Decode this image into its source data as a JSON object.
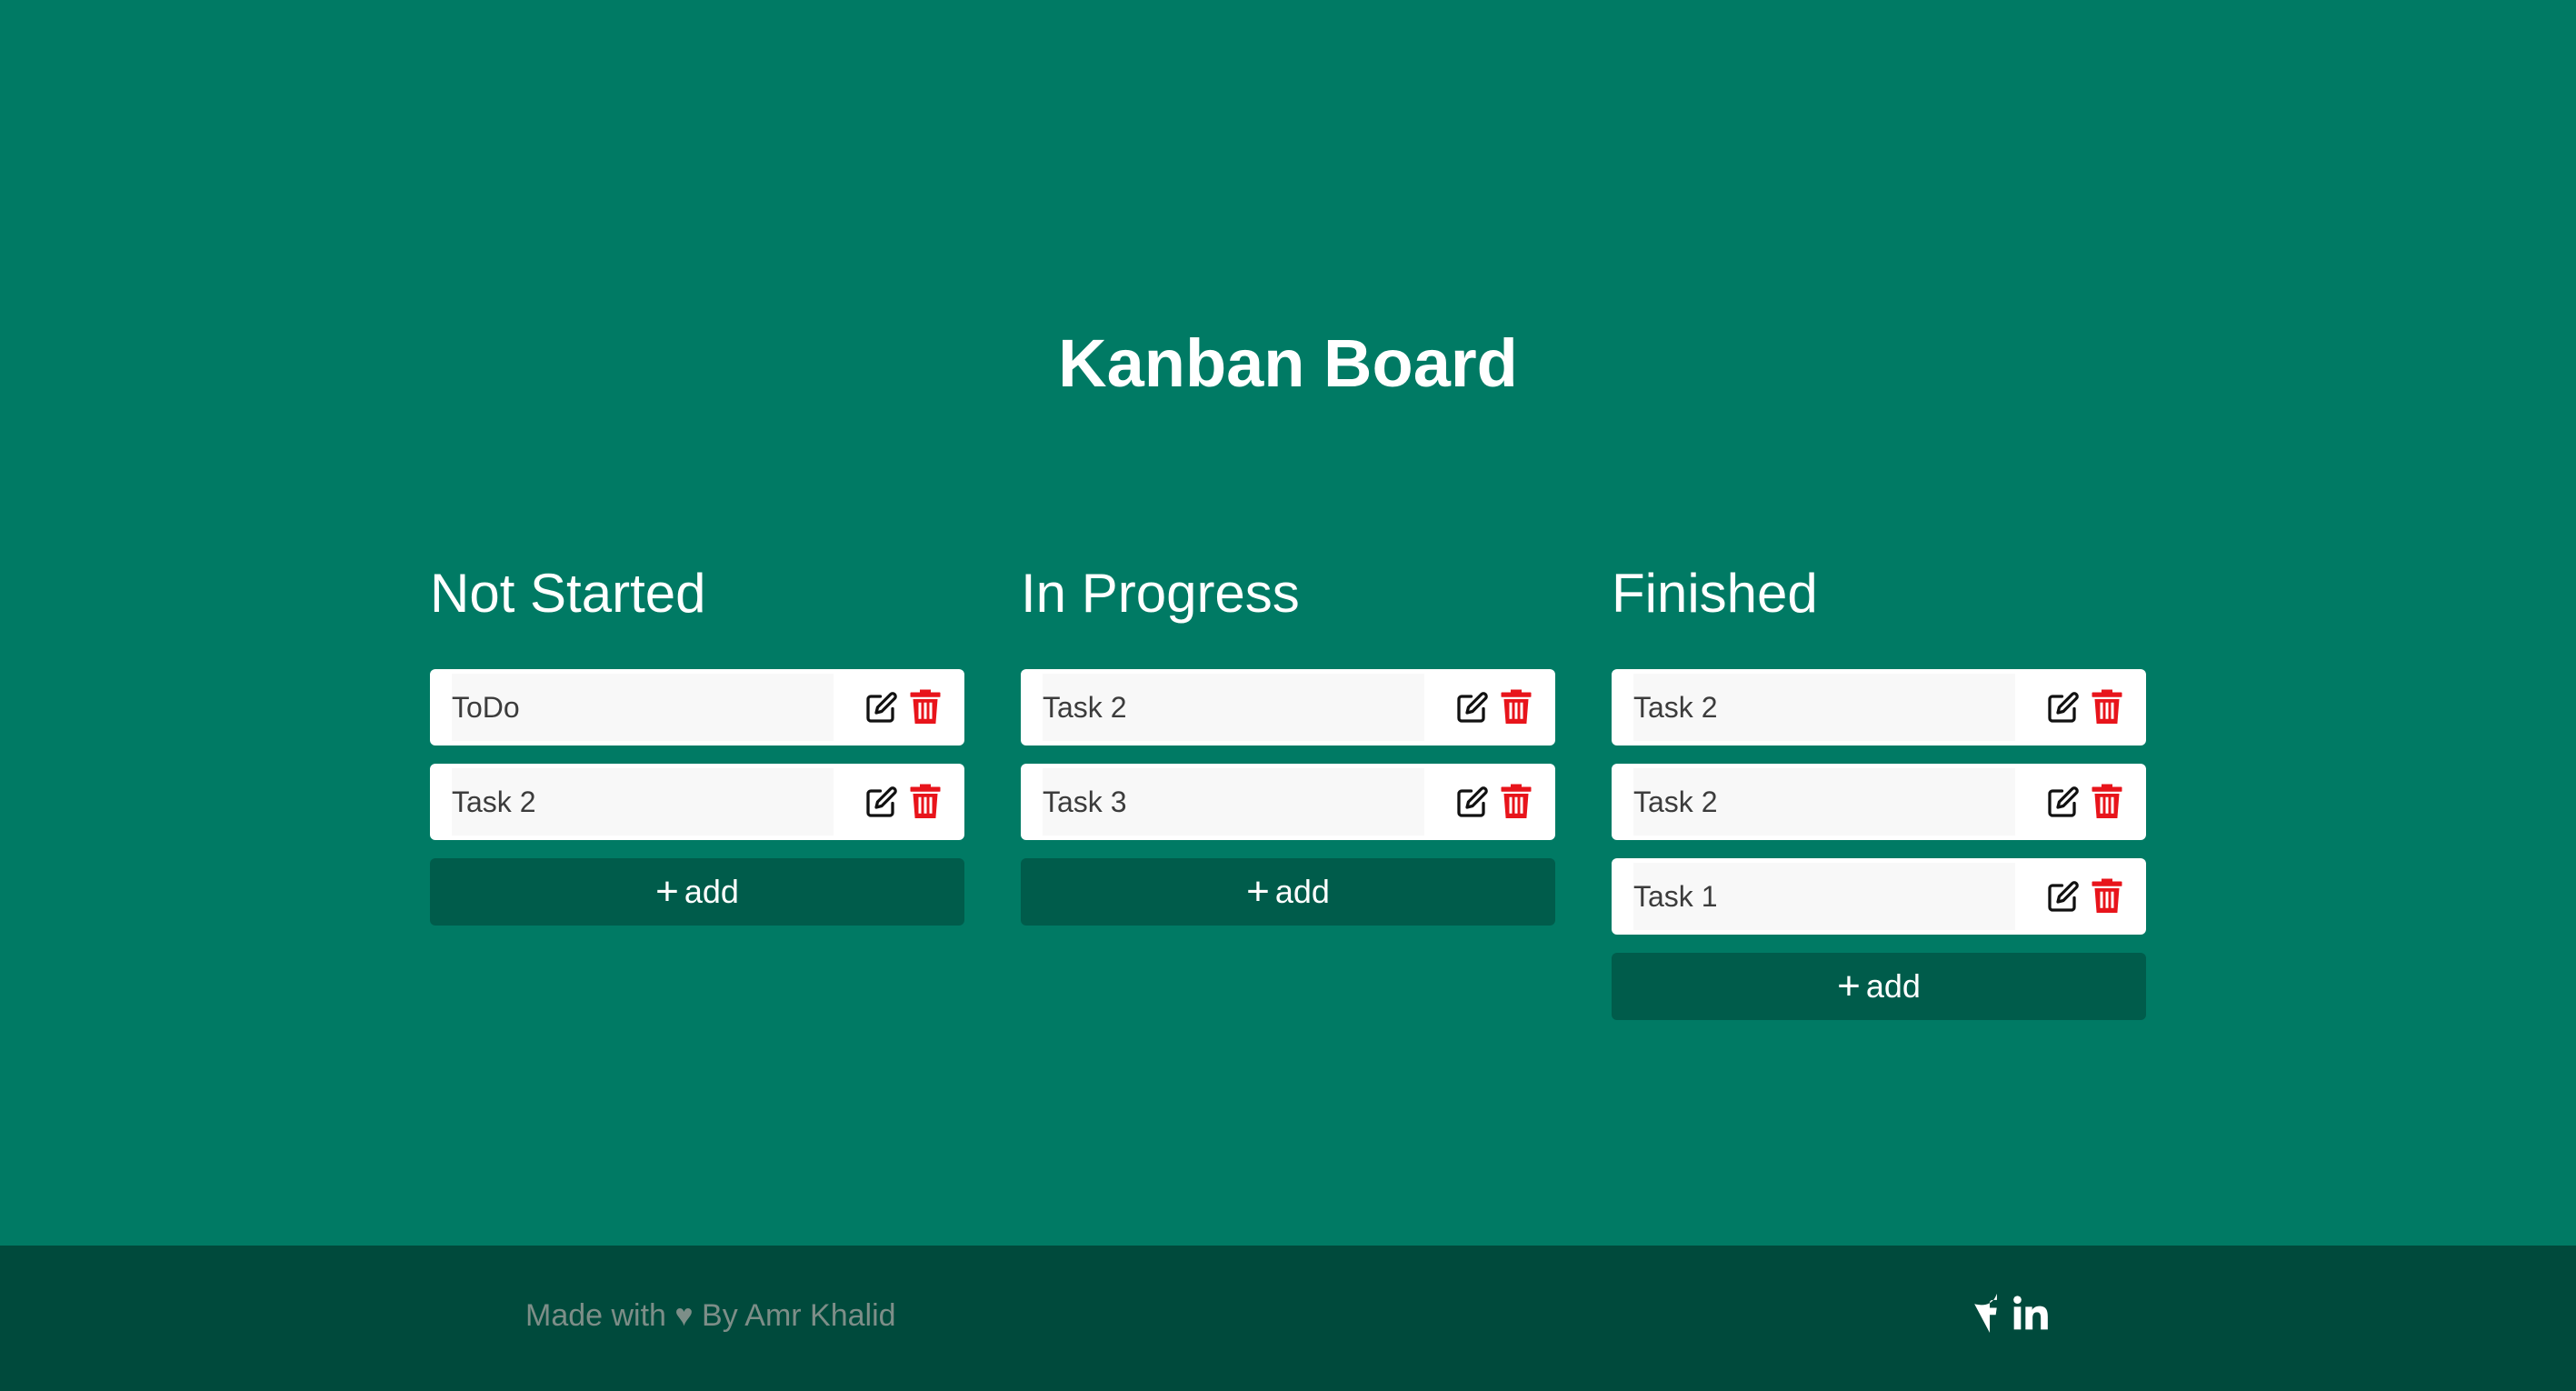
{
  "page": {
    "title": "Kanban Board"
  },
  "columns": [
    {
      "title": "Not Started",
      "tasks": [
        "ToDo",
        "Task 2"
      ],
      "add_label": "add"
    },
    {
      "title": "In Progress",
      "tasks": [
        "Task 2",
        "Task 3"
      ],
      "add_label": "add"
    },
    {
      "title": "Finished",
      "tasks": [
        "Task 2",
        "Task 2",
        "Task 1"
      ],
      "add_label": "add"
    }
  ],
  "footer": {
    "credit": "Made with ♥ By Amr Khalid",
    "social": [
      "facebook-icon",
      "linkedin-icon"
    ]
  },
  "icons": {
    "edit": "edit-icon",
    "delete": "trash-icon",
    "add": "plus-icon"
  },
  "colors": {
    "background": "#007a64",
    "add_button": "#005c4b",
    "footer": "#004a3c",
    "delete": "#e8141b",
    "card": "#ffffff"
  }
}
